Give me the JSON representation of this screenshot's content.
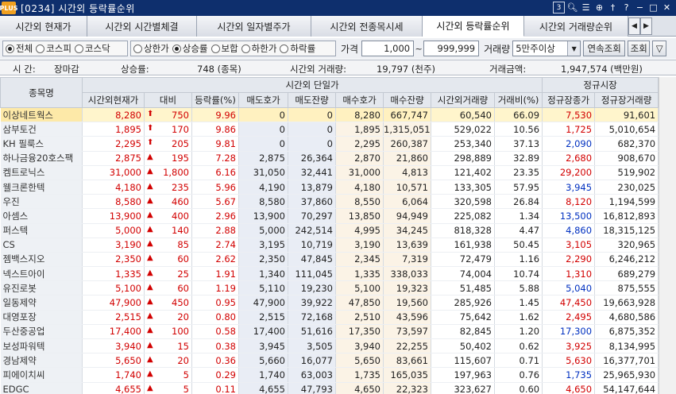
{
  "window": {
    "logo": "PLUS",
    "title": "[0234] 시간외 등락률순위",
    "icons": [
      "3",
      "search-icon",
      "list-icon",
      "zoom-icon",
      "pin-icon",
      "help-icon",
      "minimize-icon",
      "maximize-icon",
      "close-icon"
    ]
  },
  "tabs": [
    "시간외 현재가",
    "시간외 시간별체결",
    "시간외 일자별주가",
    "시간외 전종목시세",
    "시간외 등락률순위",
    "시간외 거래량순위"
  ],
  "active_tab": 4,
  "filters": {
    "market": [
      "전체",
      "코스피",
      "코스닥"
    ],
    "market_selected": 0,
    "direction": [
      "상한가",
      "상승률",
      "보합",
      "하한가",
      "하락률"
    ],
    "direction_selected": 1,
    "price_label": "가격",
    "price_from": "1,000",
    "price_to": "999,999",
    "volume_label": "거래량",
    "volume_value": "5만주이상",
    "continuous_btn": "연속조회",
    "search_btn": "조회"
  },
  "info": {
    "time_label": "시  간:",
    "time_value": "장마감",
    "rise_label": "상승률:",
    "rise_value": "748 (종목)",
    "vol_label": "시간외 거래량:",
    "vol_value": "19,797 (천주)",
    "amt_label": "거래금액:",
    "amt_value": "1,947,574 (백만원)"
  },
  "table": {
    "group_headers": {
      "name": "종목명",
      "afterhours": "시간외 단일가",
      "regular": "정규시장"
    },
    "columns": [
      "시간외현재가",
      "대비",
      "등락률(%)",
      "매도호가",
      "매도잔량",
      "매수호가",
      "매수잔량",
      "시간외거래량",
      "거래비(%)",
      "정규장종가",
      "정규장거래량"
    ],
    "rows": [
      {
        "name": "이상네트웍스",
        "price": "8,280",
        "dir": "limit",
        "chg": "750",
        "rate": "9.96",
        "ask": "0",
        "ask_qty": "0",
        "bid": "8,280",
        "bid_qty": "667,747",
        "vol": "60,540",
        "ratio": "66.09",
        "close": "7,530",
        "reg_vol": "91,601",
        "close_color": "up"
      },
      {
        "name": "삼부토건",
        "price": "1,895",
        "dir": "limit",
        "chg": "170",
        "rate": "9.86",
        "ask": "0",
        "ask_qty": "0",
        "bid": "1,895",
        "bid_qty": "1,315,051",
        "vol": "529,022",
        "ratio": "10.56",
        "close": "1,725",
        "reg_vol": "5,010,654",
        "close_color": "up"
      },
      {
        "name": "KH 필룩스",
        "price": "2,295",
        "dir": "limit",
        "chg": "205",
        "rate": "9.81",
        "ask": "0",
        "ask_qty": "0",
        "bid": "2,295",
        "bid_qty": "260,387",
        "vol": "253,340",
        "ratio": "37.13",
        "close": "2,090",
        "reg_vol": "682,370",
        "close_color": "down"
      },
      {
        "name": "하나금융20호스팩",
        "price": "2,875",
        "dir": "up",
        "chg": "195",
        "rate": "7.28",
        "ask": "2,875",
        "ask_qty": "26,364",
        "bid": "2,870",
        "bid_qty": "21,860",
        "vol": "298,889",
        "ratio": "32.89",
        "close": "2,680",
        "reg_vol": "908,670",
        "close_color": "up"
      },
      {
        "name": "켐트로닉스",
        "price": "31,000",
        "dir": "up",
        "chg": "1,800",
        "rate": "6.16",
        "ask": "31,050",
        "ask_qty": "32,441",
        "bid": "31,000",
        "bid_qty": "4,813",
        "vol": "121,402",
        "ratio": "23.35",
        "close": "29,200",
        "reg_vol": "519,902",
        "close_color": "up"
      },
      {
        "name": "웰크론한텍",
        "price": "4,180",
        "dir": "up",
        "chg": "235",
        "rate": "5.96",
        "ask": "4,190",
        "ask_qty": "13,879",
        "bid": "4,180",
        "bid_qty": "10,571",
        "vol": "133,305",
        "ratio": "57.95",
        "close": "3,945",
        "reg_vol": "230,025",
        "close_color": "down"
      },
      {
        "name": "우진",
        "price": "8,580",
        "dir": "up",
        "chg": "460",
        "rate": "5.67",
        "ask": "8,580",
        "ask_qty": "37,860",
        "bid": "8,550",
        "bid_qty": "6,064",
        "vol": "320,598",
        "ratio": "26.84",
        "close": "8,120",
        "reg_vol": "1,194,599",
        "close_color": "up"
      },
      {
        "name": "아셈스",
        "price": "13,900",
        "dir": "up",
        "chg": "400",
        "rate": "2.96",
        "ask": "13,900",
        "ask_qty": "70,297",
        "bid": "13,850",
        "bid_qty": "94,949",
        "vol": "225,082",
        "ratio": "1.34",
        "close": "13,500",
        "reg_vol": "16,812,893",
        "close_color": "down"
      },
      {
        "name": "퍼스텍",
        "price": "5,000",
        "dir": "up",
        "chg": "140",
        "rate": "2.88",
        "ask": "5,000",
        "ask_qty": "242,514",
        "bid": "4,995",
        "bid_qty": "34,245",
        "vol": "818,328",
        "ratio": "4.47",
        "close": "4,860",
        "reg_vol": "18,315,125",
        "close_color": "down"
      },
      {
        "name": "CS",
        "price": "3,190",
        "dir": "up",
        "chg": "85",
        "rate": "2.74",
        "ask": "3,195",
        "ask_qty": "10,719",
        "bid": "3,190",
        "bid_qty": "13,639",
        "vol": "161,938",
        "ratio": "50.45",
        "close": "3,105",
        "reg_vol": "320,965",
        "close_color": "up"
      },
      {
        "name": "젬백스지오",
        "price": "2,350",
        "dir": "up",
        "chg": "60",
        "rate": "2.62",
        "ask": "2,350",
        "ask_qty": "47,845",
        "bid": "2,345",
        "bid_qty": "7,319",
        "vol": "72,479",
        "ratio": "1.16",
        "close": "2,290",
        "reg_vol": "6,246,212",
        "close_color": "up"
      },
      {
        "name": "넥스트아이",
        "price": "1,335",
        "dir": "up",
        "chg": "25",
        "rate": "1.91",
        "ask": "1,340",
        "ask_qty": "111,045",
        "bid": "1,335",
        "bid_qty": "338,033",
        "vol": "74,004",
        "ratio": "10.74",
        "close": "1,310",
        "reg_vol": "689,279",
        "close_color": "up"
      },
      {
        "name": "유진로봇",
        "price": "5,100",
        "dir": "up",
        "chg": "60",
        "rate": "1.19",
        "ask": "5,110",
        "ask_qty": "19,230",
        "bid": "5,100",
        "bid_qty": "19,323",
        "vol": "51,485",
        "ratio": "5.88",
        "close": "5,040",
        "reg_vol": "875,555",
        "close_color": "down"
      },
      {
        "name": "일동제약",
        "price": "47,900",
        "dir": "up",
        "chg": "450",
        "rate": "0.95",
        "ask": "47,900",
        "ask_qty": "39,922",
        "bid": "47,850",
        "bid_qty": "19,560",
        "vol": "285,926",
        "ratio": "1.45",
        "close": "47,450",
        "reg_vol": "19,663,928",
        "close_color": "up"
      },
      {
        "name": "대영포장",
        "price": "2,515",
        "dir": "up",
        "chg": "20",
        "rate": "0.80",
        "ask": "2,515",
        "ask_qty": "72,168",
        "bid": "2,510",
        "bid_qty": "43,596",
        "vol": "75,642",
        "ratio": "1.62",
        "close": "2,495",
        "reg_vol": "4,680,586",
        "close_color": "up"
      },
      {
        "name": "두산중공업",
        "price": "17,400",
        "dir": "up",
        "chg": "100",
        "rate": "0.58",
        "ask": "17,400",
        "ask_qty": "51,616",
        "bid": "17,350",
        "bid_qty": "73,597",
        "vol": "82,845",
        "ratio": "1.20",
        "close": "17,300",
        "reg_vol": "6,875,352",
        "close_color": "down"
      },
      {
        "name": "보성파워텍",
        "price": "3,940",
        "dir": "up",
        "chg": "15",
        "rate": "0.38",
        "ask": "3,945",
        "ask_qty": "3,505",
        "bid": "3,940",
        "bid_qty": "22,255",
        "vol": "50,402",
        "ratio": "0.62",
        "close": "3,925",
        "reg_vol": "8,134,995",
        "close_color": "up"
      },
      {
        "name": "경남제약",
        "price": "5,650",
        "dir": "up",
        "chg": "20",
        "rate": "0.36",
        "ask": "5,660",
        "ask_qty": "16,077",
        "bid": "5,650",
        "bid_qty": "83,661",
        "vol": "115,607",
        "ratio": "0.71",
        "close": "5,630",
        "reg_vol": "16,377,701",
        "close_color": "up"
      },
      {
        "name": "피에이치씨",
        "price": "1,740",
        "dir": "up",
        "chg": "5",
        "rate": "0.29",
        "ask": "1,740",
        "ask_qty": "63,003",
        "bid": "1,735",
        "bid_qty": "165,035",
        "vol": "197,963",
        "ratio": "0.76",
        "close": "1,735",
        "reg_vol": "25,965,930",
        "close_color": "down"
      },
      {
        "name": "EDGC",
        "price": "4,655",
        "dir": "up",
        "chg": "5",
        "rate": "0.11",
        "ask": "4,655",
        "ask_qty": "47,793",
        "bid": "4,650",
        "bid_qty": "22,323",
        "vol": "323,627",
        "ratio": "0.60",
        "close": "4,650",
        "reg_vol": "54,147,644",
        "close_color": "up"
      }
    ]
  },
  "symbols": {
    "limit": "⬆",
    "up": "▲"
  },
  "colors": {
    "up": "#d20000",
    "down": "#0030c0",
    "titlebar": "#0e2f6d"
  }
}
